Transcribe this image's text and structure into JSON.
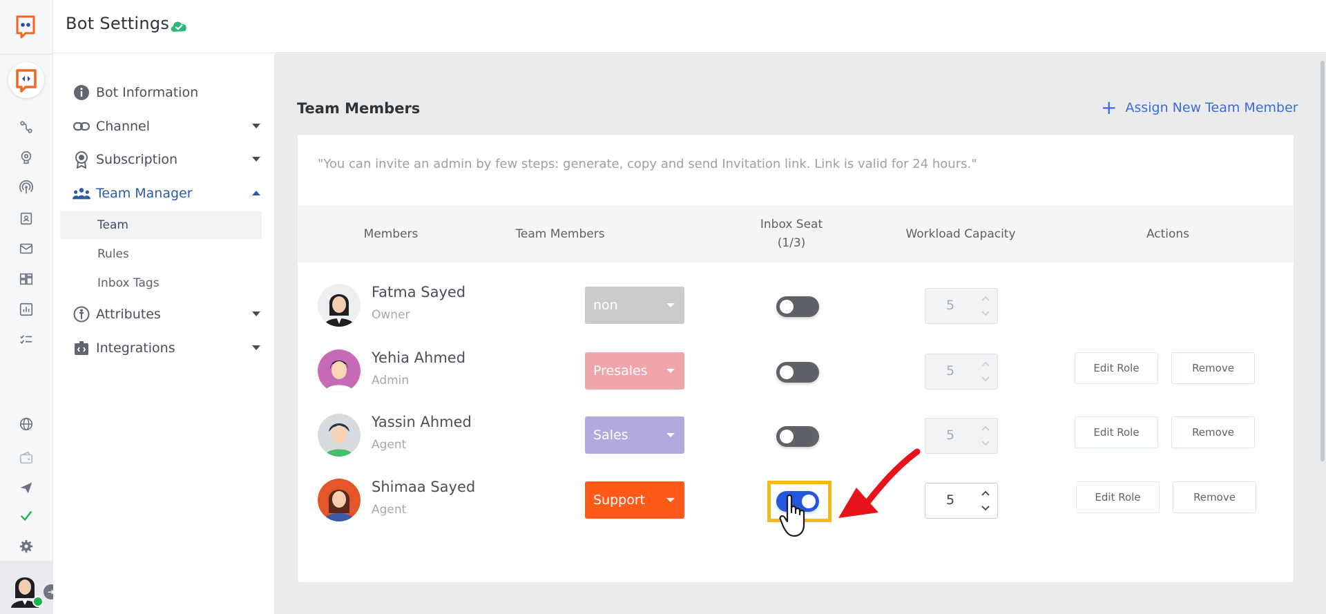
{
  "header": {
    "title": "Bot Settings"
  },
  "menu": {
    "items": [
      {
        "label": "Bot Information"
      },
      {
        "label": "Channel"
      },
      {
        "label": "Subscription"
      },
      {
        "label": "Team Manager"
      },
      {
        "label": "Attributes"
      },
      {
        "label": "Integrations"
      }
    ],
    "team_manager_sub": [
      "Team",
      "Rules",
      "Inbox Tags"
    ]
  },
  "main": {
    "section_title": "Team Members",
    "assign_label": "Assign New Team Member",
    "note": "\"You can invite an admin by few steps: generate, copy and send Invitation link. Link is valid for 24 hours.\"",
    "columns": {
      "members": "Members",
      "team_members": "Team Members",
      "inbox_seat": "Inbox Seat",
      "inbox_seat_count": "(1/3)",
      "workload": "Workload Capacity",
      "actions": "Actions"
    },
    "rows": [
      {
        "name": "Fatma Sayed",
        "role": "Owner",
        "team": "non",
        "team_color": "#cbcbcb",
        "inbox_seat": false,
        "capacity": "5"
      },
      {
        "name": "Yehia Ahmed",
        "role": "Admin",
        "team": "Presales",
        "team_color": "#f0a5ad",
        "inbox_seat": false,
        "capacity": "5",
        "edit_label": "Edit Role",
        "remove_label": "Remove"
      },
      {
        "name": "Yassin Ahmed",
        "role": "Agent",
        "team": "Sales",
        "team_color": "#b3a9df",
        "inbox_seat": false,
        "capacity": "5",
        "edit_label": "Edit Role",
        "remove_label": "Remove"
      },
      {
        "name": "Shimaa Sayed",
        "role": "Agent",
        "team": "Support",
        "team_color": "#ff5a1a",
        "inbox_seat": true,
        "capacity": "5",
        "edit_label": "Edit Role",
        "remove_label": "Remove"
      }
    ]
  },
  "colors": {
    "accent": "#2456e0",
    "link": "#3d6bd8",
    "highlight": "#f5b81c",
    "arrow": "#e8121a"
  }
}
